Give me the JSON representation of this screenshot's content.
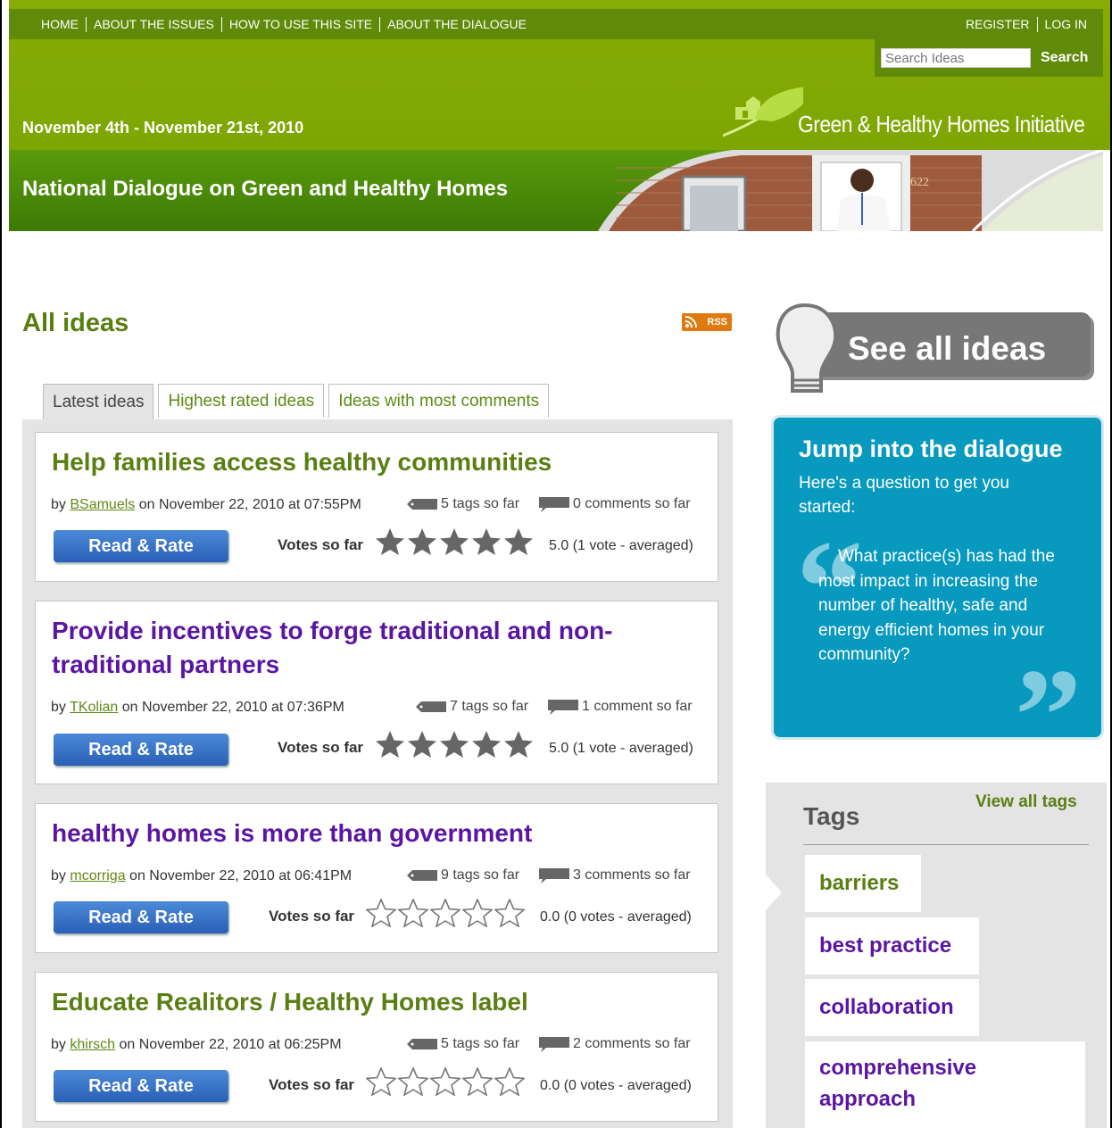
{
  "topnav": {
    "items": [
      "HOME",
      "ABOUT THE ISSUES",
      "HOW TO USE THIS SITE",
      "ABOUT THE DIALOGUE"
    ],
    "register": "REGISTER",
    "login": "LOG IN"
  },
  "search": {
    "placeholder": "Search Ideas",
    "button": "Search"
  },
  "header": {
    "dates": "November 4th - November 21st, 2010",
    "logo_text": "Green & Healthy Homes Initiative",
    "banner_title": "National Dialogue on Green and Healthy Homes",
    "house_number": "622"
  },
  "main": {
    "title": "All ideas",
    "rss": "RSS",
    "tabs": [
      "Latest ideas",
      "Highest rated ideas",
      "Ideas with most comments"
    ],
    "ideas": [
      {
        "title": "Help families access healthy communities",
        "title_color": "#5a7e12",
        "by": "by",
        "author": "BSamuels",
        "date": "on November 22, 2010 at 07:55PM",
        "tags": "5 tags so far",
        "comments": "0 comments so far",
        "button": "Read & Rate",
        "votes_label": "Votes so far",
        "rating": 5,
        "score": "5.0 (1 vote - averaged)"
      },
      {
        "title": "Provide incentives to forge traditional and non-traditional partners",
        "title_color": "#5a16a2",
        "by": "by",
        "author": "TKolian",
        "date": "on November 22, 2010 at 07:36PM",
        "tags": "7 tags so far",
        "comments": "1 comment so far",
        "button": "Read & Rate",
        "votes_label": "Votes so far",
        "rating": 5,
        "score": "5.0 (1 vote - averaged)"
      },
      {
        "title": "healthy homes is more than government",
        "title_color": "#5a16a2",
        "by": "by",
        "author": "mcorriga",
        "date": "on November 22, 2010 at 06:41PM",
        "tags": "9 tags so far",
        "comments": "3 comments so far",
        "button": "Read & Rate",
        "votes_label": "Votes so far",
        "rating": 0,
        "score": "0.0 (0 votes - averaged)"
      },
      {
        "title": "Educate Realitors / Healthy Homes label",
        "title_color": "#5a7e12",
        "by": "by",
        "author": "khirsch",
        "date": "on November 22, 2010 at 06:25PM",
        "tags": "5 tags so far",
        "comments": "2 comments so far",
        "button": "Read & Rate",
        "votes_label": "Votes so far",
        "rating": 0,
        "score": "0.0 (0 votes - averaged)"
      }
    ]
  },
  "sidebar": {
    "see_all": "See all ideas",
    "jump_title": "Jump into the dialogue",
    "jump_sub": "Here's a question to get you started:",
    "jump_question": "What practice(s) has had the most impact in increasing the number of healthy, safe and energy efficient homes in your community?",
    "tags_title": "Tags",
    "view_all_tags": "View all tags",
    "tags": [
      {
        "label": "barriers",
        "color": "#5a7e12"
      },
      {
        "label": "best practice",
        "color": "#5a16a2"
      },
      {
        "label": "collaboration",
        "color": "#5a16a2"
      },
      {
        "label": "comprehensive approach",
        "color": "#5a16a2"
      }
    ]
  },
  "colors": {
    "header_green": "#7ea603",
    "nav_green": "#5f8a0a",
    "accent_green": "#5a7e12",
    "visited_purple": "#5a16a2",
    "jump_blue": "#0799be",
    "button_blue": "#2a5fb6",
    "rss_orange": "#e07a10"
  }
}
